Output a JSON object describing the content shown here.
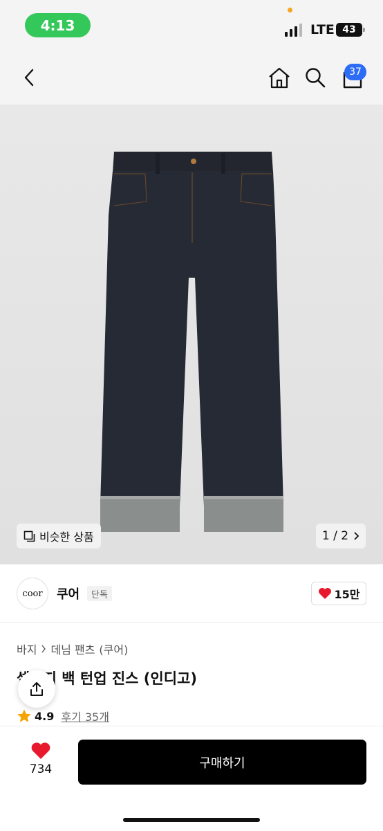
{
  "status_bar": {
    "time": "4:13",
    "network": "LTE",
    "battery": "43",
    "time_pill_color": "#34c759"
  },
  "nav": {
    "back_icon": "chevron-left-icon",
    "home_icon": "home-icon",
    "search_icon": "search-icon",
    "bag_icon": "shopping-bag-icon",
    "bag_badge": "37",
    "badge_color": "#2d6df6"
  },
  "gallery": {
    "similar_label": "비슷한 상품",
    "pager": "1 / 2"
  },
  "brand": {
    "logo_text": "coor",
    "name": "쿠어",
    "exclusive_label": "단독",
    "likes": "15만"
  },
  "product": {
    "breadcrumb": [
      "바지",
      "데님 팬츠",
      "(쿠어)"
    ],
    "title": "셀비지 백 턴업 진스 (인디고)",
    "rating": "4.9",
    "reviews": "후기 35개"
  },
  "bottom_bar": {
    "like_count": "734",
    "buy_label": "구매하기",
    "heart_color": "#e8192c"
  }
}
